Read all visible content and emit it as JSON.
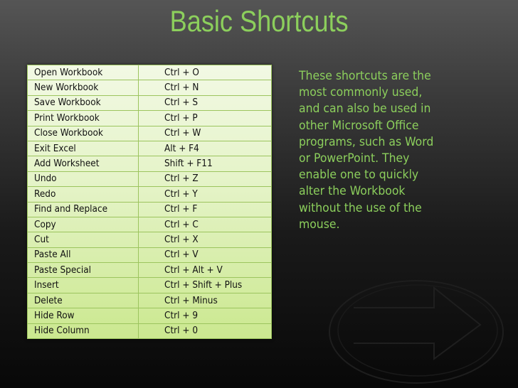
{
  "slide": {
    "title": "Basic Shortcuts",
    "accent_color": "#8ccf5c",
    "table": {
      "rows": [
        {
          "action": "Open Workbook",
          "shortcut": "Ctrl + O"
        },
        {
          "action": "New Workbook",
          "shortcut": "Ctrl + N"
        },
        {
          "action": "Save Workbook",
          "shortcut": "Ctrl + S"
        },
        {
          "action": "Print Workbook",
          "shortcut": "Ctrl + P"
        },
        {
          "action": "Close Workbook",
          "shortcut": "Ctrl + W"
        },
        {
          "action": "Exit Excel",
          "shortcut": "Alt + F4"
        },
        {
          "action": "Add Worksheet",
          "shortcut": "Shift + F11"
        },
        {
          "action": "Undo",
          "shortcut": "Ctrl + Z"
        },
        {
          "action": "Redo",
          "shortcut": "Ctrl + Y"
        },
        {
          "action": "Find and Replace",
          "shortcut": "Ctrl + F"
        },
        {
          "action": "Copy",
          "shortcut": "Ctrl + C"
        },
        {
          "action": "Cut",
          "shortcut": "Ctrl + X"
        },
        {
          "action": "Paste All",
          "shortcut": "Ctrl + V"
        },
        {
          "action": "Paste Special",
          "shortcut": "Ctrl + Alt + V"
        },
        {
          "action": "Insert",
          "shortcut": "Ctrl + Shift + Plus"
        },
        {
          "action": "Delete",
          "shortcut": "Ctrl + Minus"
        },
        {
          "action": "Hide Row",
          "shortcut": "Ctrl + 9"
        },
        {
          "action": "Hide Column",
          "shortcut": "Ctrl + 0"
        }
      ]
    },
    "description_lines": [
      "These shortcuts are the",
      "most commonly used,",
      "and can also be used in",
      "other Microsoft Office",
      "programs, such as Word",
      "or PowerPoint. They",
      "enable one to quickly",
      "alter the Workbook",
      "without the use of the",
      "mouse."
    ],
    "decorations": {
      "next_arrow_icon": "right-arrow-in-ellipse"
    }
  }
}
